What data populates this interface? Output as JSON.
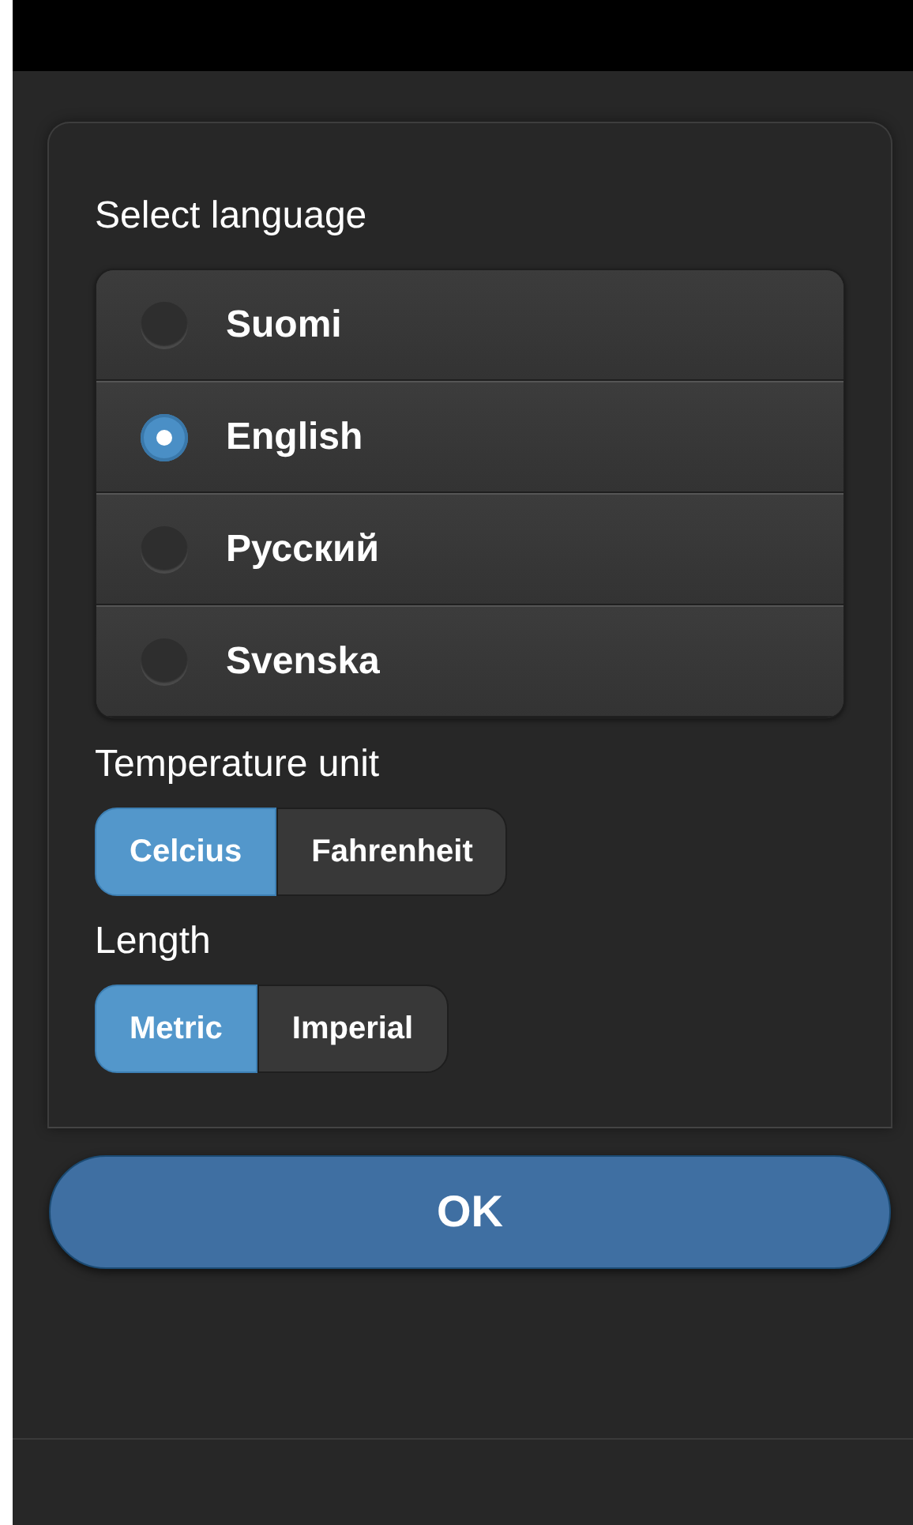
{
  "language": {
    "label": "Select language",
    "options": [
      {
        "label": "Suomi",
        "selected": false
      },
      {
        "label": "English",
        "selected": true
      },
      {
        "label": "Русский",
        "selected": false
      },
      {
        "label": "Svenska",
        "selected": false
      }
    ]
  },
  "temperature": {
    "label": "Temperature unit",
    "options": [
      {
        "label": "Celcius",
        "selected": true
      },
      {
        "label": "Fahrenheit",
        "selected": false
      }
    ]
  },
  "length": {
    "label": "Length",
    "options": [
      {
        "label": "Metric",
        "selected": true
      },
      {
        "label": "Imperial",
        "selected": false
      }
    ]
  },
  "ok_button": {
    "label": "OK"
  }
}
